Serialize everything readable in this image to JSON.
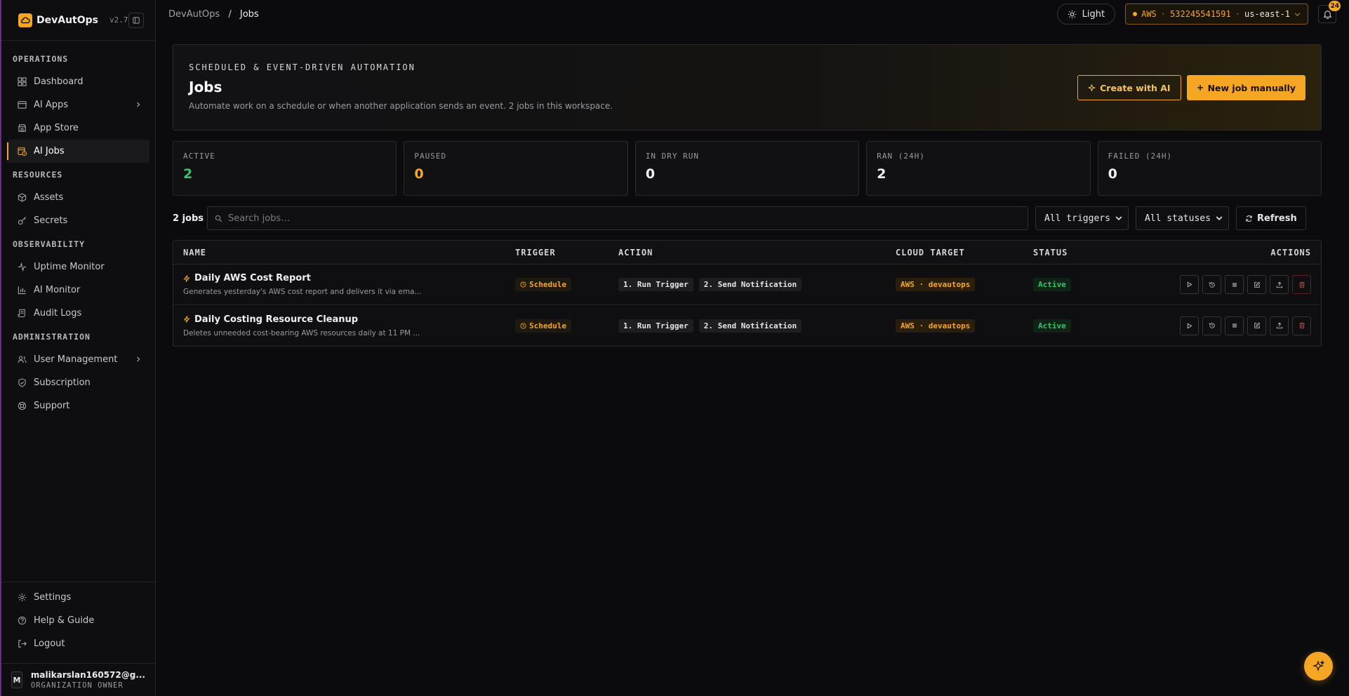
{
  "brand": {
    "name": "DevAutOps",
    "version": "v2.7"
  },
  "sidebar": {
    "sections": [
      {
        "title": "OPERATIONS",
        "items": [
          {
            "label": "Dashboard",
            "icon": "grid-icon"
          },
          {
            "label": "AI Apps",
            "icon": "window-icon",
            "chevron": true
          },
          {
            "label": "App Store",
            "icon": "store-icon"
          },
          {
            "label": "AI Jobs",
            "icon": "calendar-clock-icon",
            "active": true
          }
        ]
      },
      {
        "title": "RESOURCES",
        "items": [
          {
            "label": "Assets",
            "icon": "box-icon"
          },
          {
            "label": "Secrets",
            "icon": "key-icon"
          }
        ]
      },
      {
        "title": "OBSERVABILITY",
        "items": [
          {
            "label": "Uptime Monitor",
            "icon": "pulse-icon"
          },
          {
            "label": "AI Monitor",
            "icon": "bar-chart-icon"
          },
          {
            "label": "Audit Logs",
            "icon": "scroll-icon"
          }
        ]
      },
      {
        "title": "ADMINISTRATION",
        "items": [
          {
            "label": "User Management",
            "icon": "users-icon",
            "chevron": true
          },
          {
            "label": "Subscription",
            "icon": "shield-icon"
          },
          {
            "label": "Support",
            "icon": "lifebuoy-icon"
          }
        ]
      }
    ],
    "bottom": [
      {
        "label": "Settings",
        "icon": "gear-icon"
      },
      {
        "label": "Help & Guide",
        "icon": "help-icon"
      },
      {
        "label": "Logout",
        "icon": "logout-icon"
      }
    ],
    "user": {
      "initial": "M",
      "email": "malikarslan160572@g...",
      "role": "ORGANIZATION OWNER"
    }
  },
  "topbar": {
    "breadcrumb": [
      "DevAutOps",
      "Jobs"
    ],
    "breadcrumb_sep": "/",
    "theme_label": "Light",
    "aws": {
      "provider": "AWS",
      "account": "532245541591",
      "region": "us-east-1",
      "sep": "·"
    },
    "notifications": "24"
  },
  "hero": {
    "kicker": "SCHEDULED & EVENT-DRIVEN AUTOMATION",
    "title": "Jobs",
    "subtitle": "Automate work on a schedule or when another application sends an event. 2 jobs in this workspace.",
    "create_ai": "Create with AI",
    "new_manual": "New job manually"
  },
  "stats": [
    {
      "label": "ACTIVE",
      "value": "2",
      "color": "#34c76a"
    },
    {
      "label": "PAUSED",
      "value": "0",
      "color": "#f5a623"
    },
    {
      "label": "IN DRY RUN",
      "value": "0",
      "color": "#f0f0f2"
    },
    {
      "label": "RAN (24H)",
      "value": "2",
      "color": "#f0f0f2"
    },
    {
      "label": "FAILED (24H)",
      "value": "0",
      "color": "#f0f0f2"
    }
  ],
  "filters": {
    "count": "2 jobs",
    "search_placeholder": "Search jobs…",
    "trigger_select": "All triggers",
    "status_select": "All statuses",
    "refresh": "Refresh"
  },
  "table": {
    "headers": [
      "NAME",
      "TRIGGER",
      "ACTION",
      "CLOUD TARGET",
      "STATUS",
      "ACTIONS"
    ],
    "rows": [
      {
        "name": "Daily AWS Cost Report",
        "desc": "Generates yesterday's AWS cost report and delivers it via ema...",
        "trigger": "Schedule",
        "steps": [
          "1. Run Trigger",
          "2. Send Notification"
        ],
        "cloud": "AWS · devautops",
        "status": "Active"
      },
      {
        "name": "Daily Costing Resource Cleanup",
        "desc": "Deletes unneeded cost-bearing AWS resources daily at 11 PM ...",
        "trigger": "Schedule",
        "steps": [
          "1. Run Trigger",
          "2. Send Notification"
        ],
        "cloud": "AWS · devautops",
        "status": "Active"
      }
    ]
  }
}
